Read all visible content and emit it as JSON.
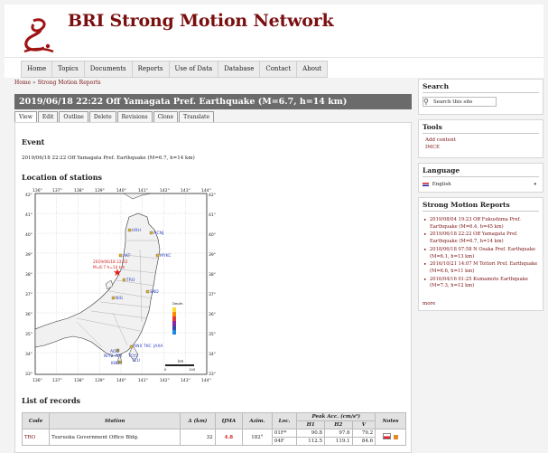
{
  "site": {
    "name": "BRI Strong Motion Network",
    "logo": "bri-logo-icon"
  },
  "nav": {
    "items": [
      "Home",
      "Topics",
      "Documents",
      "Reports",
      "Use of Data",
      "Database",
      "Contact",
      "About"
    ]
  },
  "breadcrumb": {
    "home": "Home",
    "sep": " » ",
    "current": "Strong Motion Reports"
  },
  "page": {
    "title": "2019/06/18 22:22 Off Yamagata Pref. Earthquake (M=6.7, h=14 km)",
    "tabs": [
      "View",
      "Edit",
      "Outline",
      "Delete",
      "Revisions",
      "Clone",
      "Translate"
    ],
    "active_tab": "View",
    "event_heading": "Event",
    "event_text": "2019/06/18 22:22 Off Yamagata Pref. Earthquake (M=6.7, h=14 km)",
    "location_heading": "Location of stations",
    "records_heading": "List of records"
  },
  "map": {
    "lon_ticks": [
      "136°",
      "137°",
      "138°",
      "139°",
      "140°",
      "141°",
      "142°",
      "143°",
      "144°"
    ],
    "lat_ticks_left": [
      "42°",
      "41°",
      "40°",
      "39°",
      "38°",
      "37°",
      "36°",
      "35°",
      "34°",
      "33°"
    ],
    "lat_ticks_right": [
      "42°",
      "41°",
      "40°",
      "39°",
      "38°",
      "37°",
      "36°",
      "35°",
      "34°",
      "33°"
    ],
    "epicenter_label_1": "2019/06/18 22:22",
    "epicenter_label_2": "M=6.7 h=14 km",
    "stations": [
      "HRH",
      "HCNJ",
      "AKT",
      "MYKC",
      "TRO",
      "SND",
      "NIG",
      "ANX",
      "TKC",
      "JAXA",
      "ADO",
      "NIT2",
      "NIT",
      "KWY",
      "TCY2",
      "TCU"
    ],
    "scale_label": "km",
    "scale_zero": "0",
    "scale_hundred": "100",
    "legend_title": "Depth",
    "colors": {
      "water": "#ffffff",
      "land": "#f1f1f1",
      "station": "#e2b021",
      "station_label": "#2b3fbf",
      "epicenter": "#e02020",
      "epicenter_label": "#d02020"
    }
  },
  "table": {
    "headers": {
      "code": "Code",
      "station": "Station",
      "delta": "Δ (km)",
      "ijma": "IJMA",
      "azim": "Azim.",
      "loc": "Loc.",
      "peak": "Peak Acc. (cm/s²)",
      "h1": "H1",
      "h2": "H2",
      "v": "V",
      "notes": "Notes"
    },
    "rows": [
      {
        "code": "TRO",
        "station": "Tsuruoka Government Office Bldg.",
        "delta": "32",
        "ijma": "4.8",
        "azim": "182°",
        "loc1": "01F*",
        "h1_1": "90.8",
        "h2_1": "97.6",
        "v_1": "79.2",
        "loc2": "04F",
        "h1_2": "112.5",
        "h2_2": "119.1",
        "v_2": "84.6"
      }
    ]
  },
  "sidebar": {
    "search": {
      "title": "Search",
      "placeholder": "Search this site"
    },
    "tools": {
      "title": "Tools",
      "links": [
        "Add content",
        "IMCE"
      ]
    },
    "language": {
      "title": "Language",
      "selected": "English"
    },
    "reports": {
      "title": "Strong Motion Reports",
      "items": [
        "2019/08/04 19:23 Off Fukushima Pref. Earthquake (M=6.4, h=45 km)",
        "2019/06/18 22:22 Off Yamagata Pref. Earthquake (M=6.7, h=14 km)",
        "2018/06/18 07:58 N Osaka Pref. Earthquake (M=6.1, h=13 km)",
        "2016/10/21 14:07 M Tottori Pref. Earthquake (M=6.6, h=11 km)",
        "2016/04/16 01:25 Kumamoto Earthquake (M=7.3, h=12 km)"
      ],
      "more": "more"
    }
  }
}
